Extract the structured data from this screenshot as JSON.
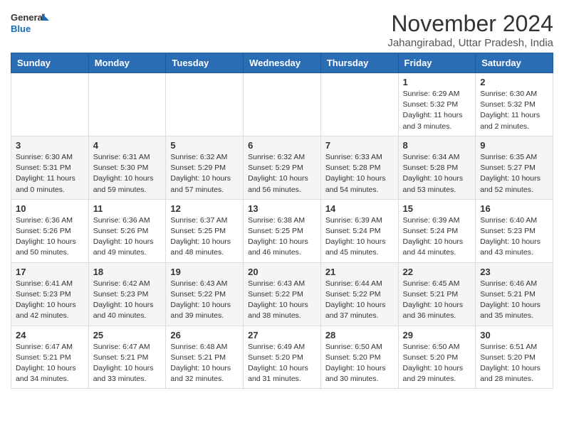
{
  "header": {
    "logo_general": "General",
    "logo_blue": "Blue",
    "month_title": "November 2024",
    "location": "Jahangirabad, Uttar Pradesh, India"
  },
  "days_of_week": [
    "Sunday",
    "Monday",
    "Tuesday",
    "Wednesday",
    "Thursday",
    "Friday",
    "Saturday"
  ],
  "weeks": [
    [
      {
        "day": "",
        "info": ""
      },
      {
        "day": "",
        "info": ""
      },
      {
        "day": "",
        "info": ""
      },
      {
        "day": "",
        "info": ""
      },
      {
        "day": "",
        "info": ""
      },
      {
        "day": "1",
        "info": "Sunrise: 6:29 AM\nSunset: 5:32 PM\nDaylight: 11 hours\nand 3 minutes."
      },
      {
        "day": "2",
        "info": "Sunrise: 6:30 AM\nSunset: 5:32 PM\nDaylight: 11 hours\nand 2 minutes."
      }
    ],
    [
      {
        "day": "3",
        "info": "Sunrise: 6:30 AM\nSunset: 5:31 PM\nDaylight: 11 hours\nand 0 minutes."
      },
      {
        "day": "4",
        "info": "Sunrise: 6:31 AM\nSunset: 5:30 PM\nDaylight: 10 hours\nand 59 minutes."
      },
      {
        "day": "5",
        "info": "Sunrise: 6:32 AM\nSunset: 5:29 PM\nDaylight: 10 hours\nand 57 minutes."
      },
      {
        "day": "6",
        "info": "Sunrise: 6:32 AM\nSunset: 5:29 PM\nDaylight: 10 hours\nand 56 minutes."
      },
      {
        "day": "7",
        "info": "Sunrise: 6:33 AM\nSunset: 5:28 PM\nDaylight: 10 hours\nand 54 minutes."
      },
      {
        "day": "8",
        "info": "Sunrise: 6:34 AM\nSunset: 5:28 PM\nDaylight: 10 hours\nand 53 minutes."
      },
      {
        "day": "9",
        "info": "Sunrise: 6:35 AM\nSunset: 5:27 PM\nDaylight: 10 hours\nand 52 minutes."
      }
    ],
    [
      {
        "day": "10",
        "info": "Sunrise: 6:36 AM\nSunset: 5:26 PM\nDaylight: 10 hours\nand 50 minutes."
      },
      {
        "day": "11",
        "info": "Sunrise: 6:36 AM\nSunset: 5:26 PM\nDaylight: 10 hours\nand 49 minutes."
      },
      {
        "day": "12",
        "info": "Sunrise: 6:37 AM\nSunset: 5:25 PM\nDaylight: 10 hours\nand 48 minutes."
      },
      {
        "day": "13",
        "info": "Sunrise: 6:38 AM\nSunset: 5:25 PM\nDaylight: 10 hours\nand 46 minutes."
      },
      {
        "day": "14",
        "info": "Sunrise: 6:39 AM\nSunset: 5:24 PM\nDaylight: 10 hours\nand 45 minutes."
      },
      {
        "day": "15",
        "info": "Sunrise: 6:39 AM\nSunset: 5:24 PM\nDaylight: 10 hours\nand 44 minutes."
      },
      {
        "day": "16",
        "info": "Sunrise: 6:40 AM\nSunset: 5:23 PM\nDaylight: 10 hours\nand 43 minutes."
      }
    ],
    [
      {
        "day": "17",
        "info": "Sunrise: 6:41 AM\nSunset: 5:23 PM\nDaylight: 10 hours\nand 42 minutes."
      },
      {
        "day": "18",
        "info": "Sunrise: 6:42 AM\nSunset: 5:23 PM\nDaylight: 10 hours\nand 40 minutes."
      },
      {
        "day": "19",
        "info": "Sunrise: 6:43 AM\nSunset: 5:22 PM\nDaylight: 10 hours\nand 39 minutes."
      },
      {
        "day": "20",
        "info": "Sunrise: 6:43 AM\nSunset: 5:22 PM\nDaylight: 10 hours\nand 38 minutes."
      },
      {
        "day": "21",
        "info": "Sunrise: 6:44 AM\nSunset: 5:22 PM\nDaylight: 10 hours\nand 37 minutes."
      },
      {
        "day": "22",
        "info": "Sunrise: 6:45 AM\nSunset: 5:21 PM\nDaylight: 10 hours\nand 36 minutes."
      },
      {
        "day": "23",
        "info": "Sunrise: 6:46 AM\nSunset: 5:21 PM\nDaylight: 10 hours\nand 35 minutes."
      }
    ],
    [
      {
        "day": "24",
        "info": "Sunrise: 6:47 AM\nSunset: 5:21 PM\nDaylight: 10 hours\nand 34 minutes."
      },
      {
        "day": "25",
        "info": "Sunrise: 6:47 AM\nSunset: 5:21 PM\nDaylight: 10 hours\nand 33 minutes."
      },
      {
        "day": "26",
        "info": "Sunrise: 6:48 AM\nSunset: 5:21 PM\nDaylight: 10 hours\nand 32 minutes."
      },
      {
        "day": "27",
        "info": "Sunrise: 6:49 AM\nSunset: 5:20 PM\nDaylight: 10 hours\nand 31 minutes."
      },
      {
        "day": "28",
        "info": "Sunrise: 6:50 AM\nSunset: 5:20 PM\nDaylight: 10 hours\nand 30 minutes."
      },
      {
        "day": "29",
        "info": "Sunrise: 6:50 AM\nSunset: 5:20 PM\nDaylight: 10 hours\nand 29 minutes."
      },
      {
        "day": "30",
        "info": "Sunrise: 6:51 AM\nSunset: 5:20 PM\nDaylight: 10 hours\nand 28 minutes."
      }
    ]
  ]
}
